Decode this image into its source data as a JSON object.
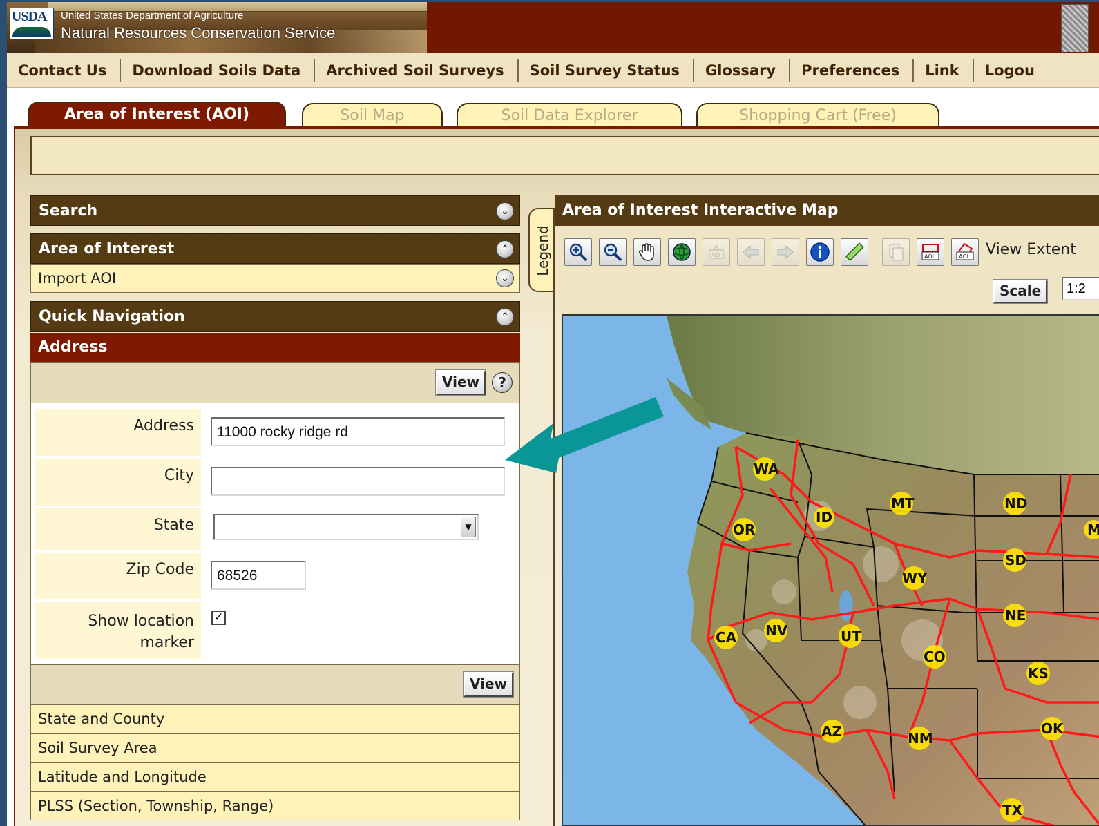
{
  "header": {
    "logo_text": "USDA",
    "department": "United States Department of Agriculture",
    "agency": "Natural Resources Conservation Service"
  },
  "topnav": {
    "items": [
      "Contact Us",
      "Download Soils Data",
      "Archived Soil Surveys",
      "Soil Survey Status",
      "Glossary",
      "Preferences",
      "Link",
      "Logou"
    ]
  },
  "tabs": {
    "aoi": "Area of Interest (AOI)",
    "soil_map": "Soil Map",
    "soil_data_explorer": "Soil Data Explorer",
    "shopping_cart": "Shopping Cart (Free)"
  },
  "left": {
    "search": "Search",
    "area_of_interest": "Area of Interest",
    "import_aoi": "Import AOI",
    "quick_navigation": "Quick Navigation",
    "address_section": "Address",
    "view_label": "View",
    "help_glyph": "?",
    "form": {
      "address_label": "Address",
      "address_value": "11000 rocky ridge rd",
      "city_label": "City",
      "city_value": "",
      "state_label": "State",
      "state_value": "",
      "zip_label": "Zip Code",
      "zip_value": "68526",
      "show_marker_label_1": "Show location",
      "show_marker_label_2": "marker",
      "show_marker_checked": true
    },
    "other_sections": [
      "State and County",
      "Soil Survey Area",
      "Latitude and Longitude",
      "PLSS (Section, Township, Range)"
    ]
  },
  "legend": {
    "label": "Legend"
  },
  "map": {
    "title": "Area of Interest Interactive Map",
    "view_extent_label": "View Extent",
    "scale_label": "Scale",
    "scale_value": "1:2",
    "tools": [
      "zoom-in-icon",
      "zoom-out-icon",
      "pan-hand-icon",
      "full-extent-globe-icon",
      "aoi-define-icon",
      "previous-extent-icon",
      "next-extent-icon",
      "identify-info-icon",
      "measure-ruler-icon",
      "copy-icon",
      "aoi-rectangle-icon",
      "aoi-polygon-icon"
    ],
    "state_labels": [
      "WA",
      "OR",
      "ID",
      "MT",
      "ND",
      "SD",
      "WY",
      "NE",
      "CA",
      "NV",
      "UT",
      "CO",
      "KS",
      "AZ",
      "NM",
      "OK",
      "TX",
      "M"
    ]
  },
  "colors": {
    "banner": "#721800",
    "panel_header": "#553b14",
    "address_header": "#7d1a00",
    "light_row": "#fff2b8",
    "arrow": "#0a9696",
    "roads": "#ff1a1a",
    "ocean": "#7cb6e8"
  }
}
